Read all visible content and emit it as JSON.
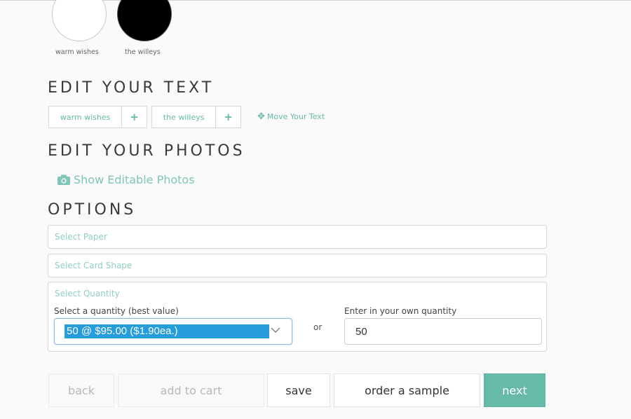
{
  "swatches": [
    {
      "label": "warm wishes",
      "color": "#ffffff"
    },
    {
      "label": "the willeys",
      "color": "#000000"
    }
  ],
  "edit_text": {
    "heading": "EDIT YOUR TEXT",
    "chips": [
      {
        "label": "warm wishes",
        "plus": "+"
      },
      {
        "label": "the willeys",
        "plus": "+"
      }
    ],
    "move_icon": "✥",
    "move_label": "Move Your Text"
  },
  "edit_photos": {
    "heading": "EDIT YOUR PHOTOS",
    "show_label": "Show Editable Photos"
  },
  "options": {
    "heading": "OPTIONS",
    "paper_label": "Select Paper",
    "shape_label": "Select Card Shape",
    "quantity": {
      "title": "Select Quantity",
      "select_label": "Select a quantity (best value)",
      "selected_value": "50 @ $95.00 ($1.90ea.)",
      "or_text": "or",
      "own_label": "Enter in your own quantity",
      "own_value": "50"
    }
  },
  "buttons": {
    "back": "back",
    "add_to_cart": "add to cart",
    "save": "save",
    "order_sample": "order a sample",
    "next": "next"
  },
  "colors": {
    "accent": "#67b9a8",
    "accent_text": "#66b8a8",
    "selection": "#269ddb"
  }
}
